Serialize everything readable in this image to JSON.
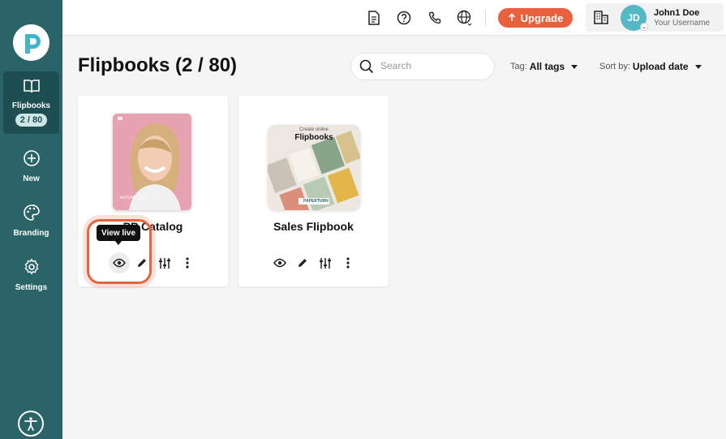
{
  "sidebar": {
    "items": [
      {
        "label": "Flipbooks",
        "badge": "2 / 80",
        "icon": "book-icon"
      },
      {
        "label": "New",
        "icon": "plus-circle-icon"
      },
      {
        "label": "Branding",
        "icon": "palette-icon"
      },
      {
        "label": "Settings",
        "icon": "gear-icon"
      }
    ]
  },
  "header": {
    "upgrade_label": "Upgrade",
    "user": {
      "initials": "JD",
      "name": "John1 Doe",
      "subtitle": "Your Username"
    }
  },
  "main": {
    "title": "Flipbooks (2 / 80)",
    "search_placeholder": "Search",
    "tag_filter": {
      "label": "Tag:",
      "value": "All tags"
    },
    "sort": {
      "label": "Sort by:",
      "value": "Upload date"
    },
    "tooltip": "View live",
    "cards": [
      {
        "title": "PP Catalog",
        "cover_text": "AUTUMN 2022"
      },
      {
        "title": "Sales Flipbook",
        "cover_text_top": "Create online",
        "cover_text_main": "Flipbooks",
        "cover_brand": "PAPERTURN"
      }
    ]
  },
  "colors": {
    "sidebar": "#2a6468",
    "sidebar_active": "#1d4e52",
    "accent": "#e8603c",
    "avatar": "#55b8c5"
  }
}
